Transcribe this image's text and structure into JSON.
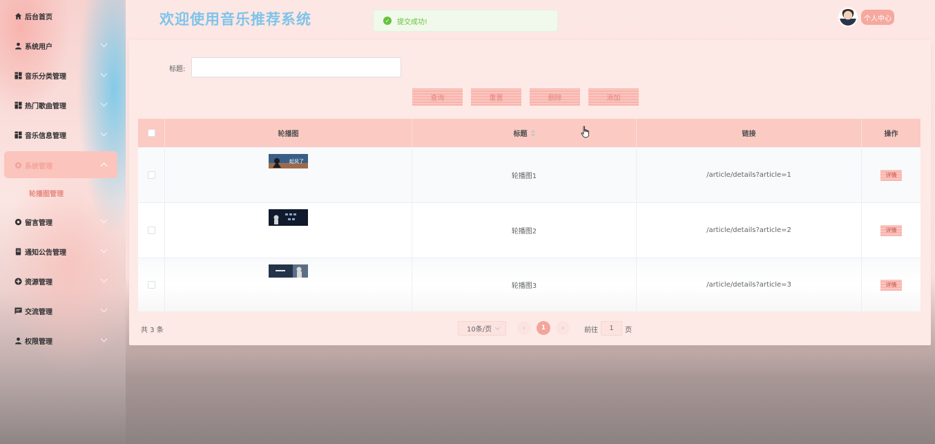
{
  "app": {
    "title": "欢迎使用音乐推荐系统",
    "toast": "提交成功!",
    "user_center": "个人中心"
  },
  "sidebar": {
    "items": [
      {
        "label": "后台首页",
        "icon": "home-icon"
      },
      {
        "label": "系统用户",
        "icon": "user-icon"
      },
      {
        "label": "音乐分类管理",
        "icon": "grid-icon"
      },
      {
        "label": "热门歌曲管理",
        "icon": "grid-icon"
      },
      {
        "label": "音乐信息管理",
        "icon": "grid-icon"
      },
      {
        "label": "系统管理",
        "icon": "gear-icon",
        "active": true
      },
      {
        "label": "留言管理",
        "icon": "gear-icon"
      },
      {
        "label": "通知公告管理",
        "icon": "document-icon"
      },
      {
        "label": "资源管理",
        "icon": "plus-circle-icon"
      },
      {
        "label": "交流管理",
        "icon": "chat-icon"
      },
      {
        "label": "权限管理",
        "icon": "user-icon"
      }
    ],
    "submenu": "轮播图管理"
  },
  "search": {
    "label": "标题:",
    "value": "",
    "placeholder": ""
  },
  "actions": {
    "query": "查询",
    "reset": "重置",
    "delete": "删除",
    "add": "添加"
  },
  "table": {
    "headers": {
      "image": "轮播图",
      "title": "标题",
      "link": "链接",
      "action": "操作"
    },
    "rows": [
      {
        "title": "轮播图1",
        "link": "/article/details?article=1",
        "action": "详情",
        "thumb_text": "起风了"
      },
      {
        "title": "轮播图2",
        "link": "/article/details?article=2",
        "action": "详情",
        "thumb_text": ""
      },
      {
        "title": "轮播图3",
        "link": "/article/details?article=3",
        "action": "详情",
        "thumb_text": ""
      }
    ]
  },
  "pagination": {
    "total": "共 3 条",
    "page_size": "10条/页",
    "current": "1",
    "goto_label": "前往",
    "goto_value": "1",
    "page_unit": "页"
  },
  "colors": {
    "accent": "#f3a59c",
    "title_blue": "#7ec4ea",
    "success": "#67c23a"
  }
}
